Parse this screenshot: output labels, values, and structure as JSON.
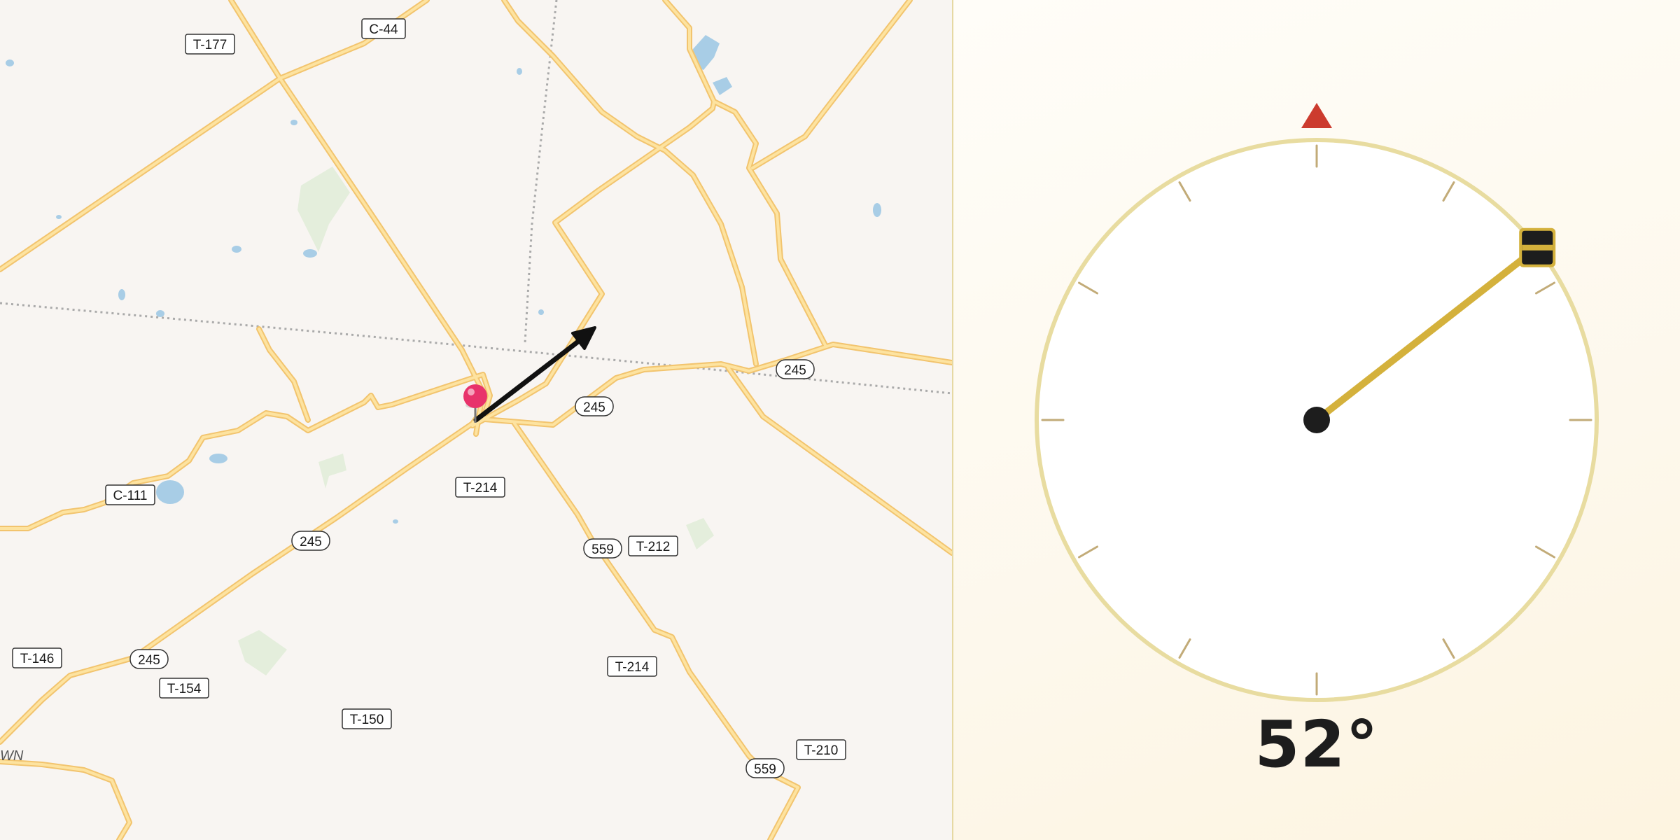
{
  "map": {
    "route_labels": [
      {
        "id": "t177",
        "text": "T-177",
        "style": "box"
      },
      {
        "id": "c44",
        "text": "C-44",
        "style": "box"
      },
      {
        "id": "c111",
        "text": "C-111",
        "style": "box"
      },
      {
        "id": "t214a",
        "text": "T-214",
        "style": "box"
      },
      {
        "id": "t212",
        "text": "T-212",
        "style": "box"
      },
      {
        "id": "t146",
        "text": "T-146",
        "style": "box"
      },
      {
        "id": "t154",
        "text": "T-154",
        "style": "box"
      },
      {
        "id": "t150",
        "text": "T-150",
        "style": "box"
      },
      {
        "id": "t214b",
        "text": "T-214",
        "style": "box"
      },
      {
        "id": "t210",
        "text": "T-210",
        "style": "box"
      },
      {
        "id": "r245a",
        "text": "245",
        "style": "shield"
      },
      {
        "id": "r245b",
        "text": "245",
        "style": "shield"
      },
      {
        "id": "r245c",
        "text": "245",
        "style": "shield"
      },
      {
        "id": "r245d",
        "text": "245",
        "style": "shield"
      },
      {
        "id": "r559a",
        "text": "559",
        "style": "shield"
      },
      {
        "id": "r559b",
        "text": "559",
        "style": "shield"
      }
    ],
    "place_label": "WN",
    "colors": {
      "background": "#f8f5f2",
      "road_fill": "#fde3a0",
      "road_casing": "#f2c46e",
      "water": "#a8cde6",
      "park": "#e4eedc",
      "boundary": "#aaaaaa",
      "pin": "#e8336b"
    },
    "pin_icon": "map-pin-icon",
    "direction_arrow_icon": "direction-arrow-icon"
  },
  "compass": {
    "heading_degrees": 52,
    "heading_text": "52°",
    "north_marker_icon": "north-triangle-icon",
    "colors": {
      "dial_rim": "#e8dca0",
      "needle": "#d4b13c",
      "north_marker": "#cc3b2e",
      "ticks": "#c2ab78",
      "hub": "#1d1d1d"
    }
  }
}
